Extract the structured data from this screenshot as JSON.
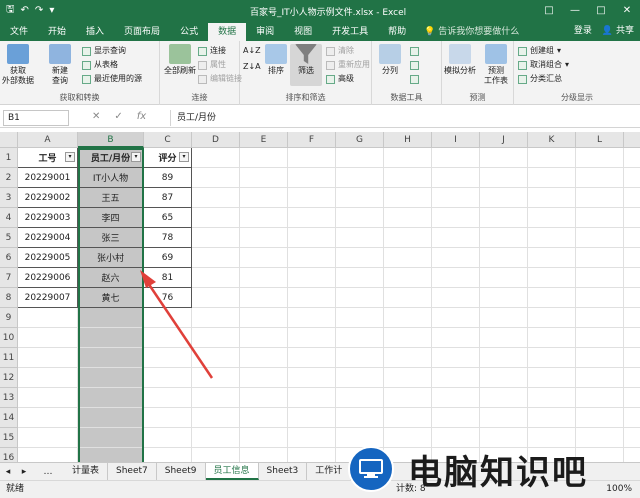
{
  "window": {
    "title": "百家号_IT小人物示例文件.xlsx - Excel",
    "controls": [
      "□",
      "—",
      "□",
      "✕"
    ]
  },
  "quick_access": [
    "🖫",
    "↶",
    "↷",
    "▾"
  ],
  "tabs": [
    "文件",
    "开始",
    "插入",
    "页面布局",
    "公式",
    "数据",
    "审阅",
    "视图",
    "开发工具",
    "帮助"
  ],
  "active_tab": "数据",
  "tell_me": "告诉我你想要做什么",
  "account": {
    "login": "登录",
    "share": "共享"
  },
  "ribbon": {
    "get_external": "获取\n外部数据",
    "new_query": "新建\n查询",
    "show_queries": "显示查询",
    "from_table": "从表格",
    "recent_sources": "最近使用的源",
    "group_get": "获取和转换",
    "refresh_all": "全部刷新",
    "connections": "连接",
    "properties": "属性",
    "edit_links": "编辑链接",
    "group_conn": "连接",
    "sort": "排序",
    "filter": "筛选",
    "clear": "清除",
    "reapply": "重新应用",
    "advanced": "高级",
    "group_sort": "排序和筛选",
    "split": "分列",
    "group_tools": "数据工具",
    "whatif": "模拟分析",
    "forecast": "预测\n工作表",
    "group_forecast": "预测",
    "group_btn": "创建组",
    "ungroup": "取消组合",
    "subtotal": "分类汇总",
    "group_outline": "分级显示"
  },
  "name_box": "B1",
  "formula_icons": [
    "✕",
    "✓",
    "fx"
  ],
  "formula_value": "员工/月份",
  "columns": [
    "A",
    "B",
    "C",
    "D",
    "E",
    "F",
    "G",
    "H",
    "I",
    "J",
    "K",
    "L",
    "M",
    "N",
    "O"
  ],
  "rows": [
    "1",
    "2",
    "3",
    "4",
    "5",
    "6",
    "7",
    "8",
    "9",
    "10",
    "11",
    "12",
    "13",
    "14",
    "15",
    "16",
    "17"
  ],
  "table": {
    "headers": [
      "工号",
      "员工/月份",
      "评分"
    ],
    "data": [
      [
        "20229001",
        "IT小人物",
        "89"
      ],
      [
        "20229002",
        "王五",
        "87"
      ],
      [
        "20229003",
        "李四",
        "65"
      ],
      [
        "20229004",
        "张三",
        "78"
      ],
      [
        "20229005",
        "张小村",
        "69"
      ],
      [
        "20229006",
        "赵六",
        "81"
      ],
      [
        "20229007",
        "黄七",
        "76"
      ]
    ]
  },
  "sheet_tabs": [
    "计量表",
    "Sheet7",
    "Sheet9",
    "员工信息",
    "Sheet3",
    "工作计"
  ],
  "active_sheet": "员工信息",
  "status": {
    "ready": "就绪",
    "count": "计数: 8",
    "zoom": "100%"
  },
  "watermark": "电脑知识吧"
}
